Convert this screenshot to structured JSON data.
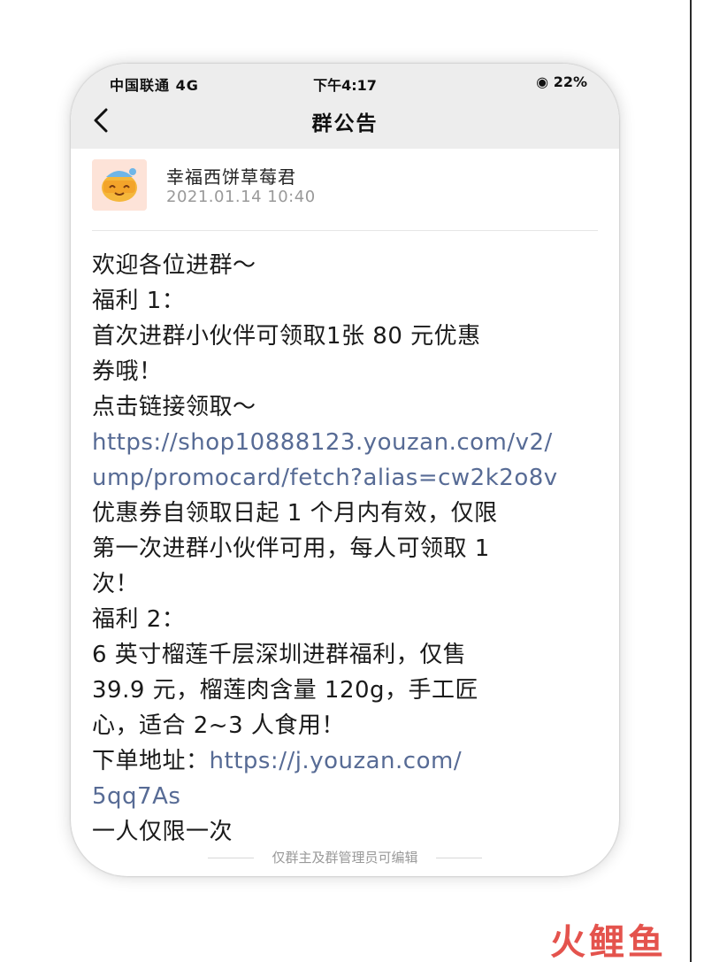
{
  "status_bar": {
    "carrier": "中国联通 4G",
    "time": "下午4:17",
    "battery": "◉ 22%"
  },
  "nav": {
    "back_icon": "chevron-left-icon",
    "title": "群公告"
  },
  "author": {
    "name": "幸福西饼草莓君",
    "timestamp": "2021.01.14  10:40"
  },
  "announcement": {
    "line1": "欢迎各位进群～",
    "line2": "福利 1：",
    "line3": "首次进群小伙伴可领取1张 80 元优惠",
    "line4": "券哦！",
    "line5": "点击链接领取～",
    "link1_part1": "https://shop10888123.youzan.com/v2/",
    "link1_part2": "ump/promocard/fetch?alias=cw2k2o8v",
    "line8": "优惠券自领取日起 1 个月内有效，仅限",
    "line9": "第一次进群小伙伴可用，每人可领取 1",
    "line10": "次！",
    "line11": "福利 2：",
    "line12": "6 英寸榴莲千层深圳进群福利，仅售",
    "line13": "39.9 元，榴莲肉含量 120g，手工匠",
    "line14": "心，适合 2~3 人食用！",
    "line15_label": "下单地址：",
    "link2_part1": "https://j.youzan.com/",
    "link2_part2": "5qq7As",
    "line17": "一人仅限一次"
  },
  "footer": {
    "note": "仅群主及群管理员可编辑"
  },
  "watermark": {
    "text": "火鲤鱼"
  },
  "colors": {
    "link": "#576b95",
    "header_bg": "#ededed",
    "watermark": "#e0362f"
  }
}
